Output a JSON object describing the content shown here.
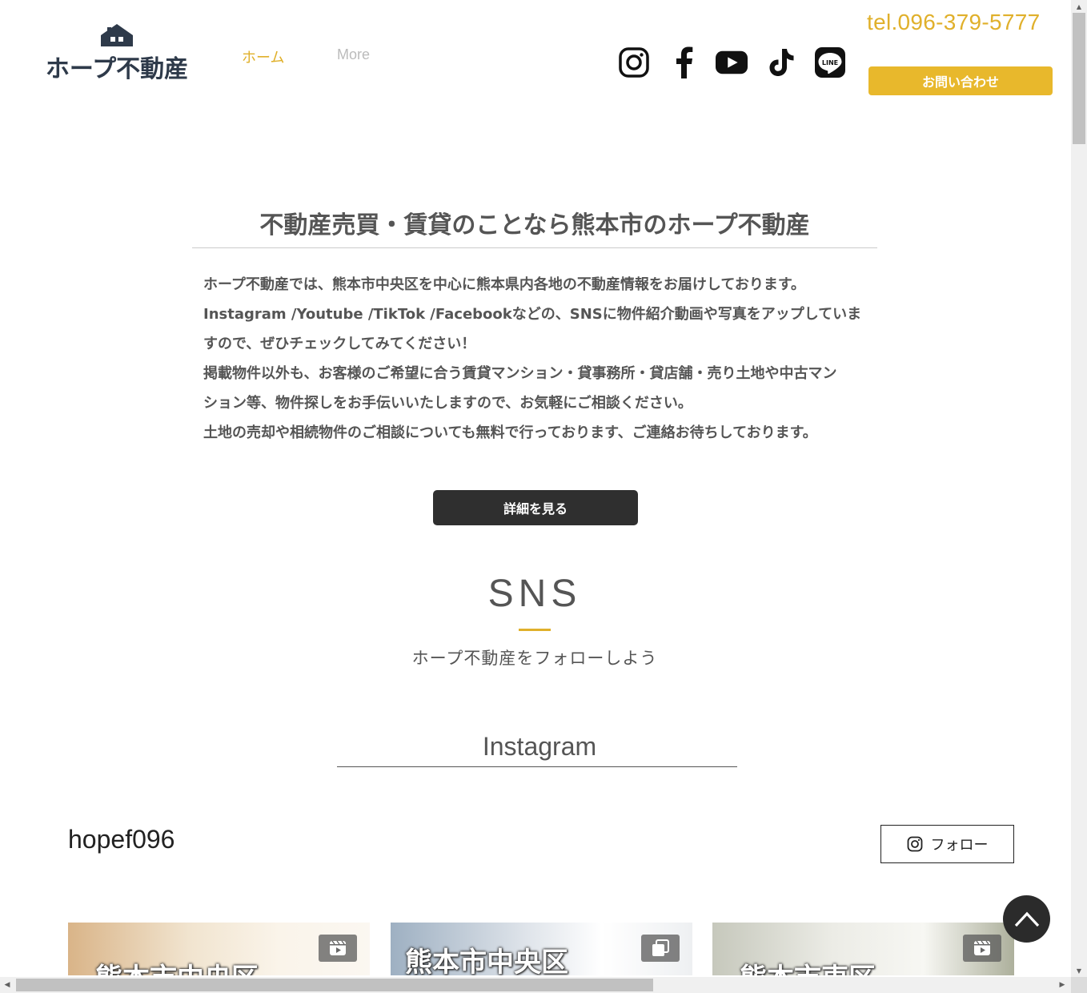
{
  "header": {
    "logo_text": "ホープ不動産",
    "nav": [
      {
        "label": "ホーム"
      },
      {
        "label": "More"
      }
    ],
    "social_icons": [
      "instagram-icon",
      "facebook-icon",
      "youtube-icon",
      "tiktok-icon",
      "line-icon"
    ],
    "line_icon_text": "LINE",
    "tel": "tel.096-379-5777",
    "contact_label": "お問い合わせ"
  },
  "intro": {
    "headline": "不動産売買・賃貸のことなら熊本市のホープ不動産",
    "lines": [
      "ホープ不動産では、熊本市中央区を中心に熊本県内各地の不動産情報をお届けしております。",
      "Instagram /Youtube /TikTok /Facebookなどの、SNSに物件紹介動画や写真をアップしていま",
      "すので、ぜひチェックしてみてください！",
      "掲載物件以外も、お客様のご希望に合う賃貸マンション・貸事務所・貸店舗・売り土地や中古マン",
      "ション等、物件探しをお手伝いいたしますので、お気軽にご相談ください。",
      "土地の売却や相続物件のご相談についても無料で行っております、ご連絡お待ちしております。"
    ],
    "detail_button": "詳細を見る"
  },
  "sns": {
    "title": "SNS",
    "subtitle": "ホープ不動産をフォローしよう",
    "instagram_title": "Instagram",
    "handle": "hopef096",
    "follow_label": "フォロー",
    "tiles": [
      {
        "text": "熊本市中央区",
        "badge": "reel-icon"
      },
      {
        "text": "熊本市中央区",
        "badge": "carousel-icon"
      },
      {
        "text": "熊本市東区",
        "badge": "reel-icon"
      }
    ]
  },
  "colors": {
    "accent": "#e0b02b",
    "button_dark": "#2f2f2f",
    "text": "#555555"
  }
}
